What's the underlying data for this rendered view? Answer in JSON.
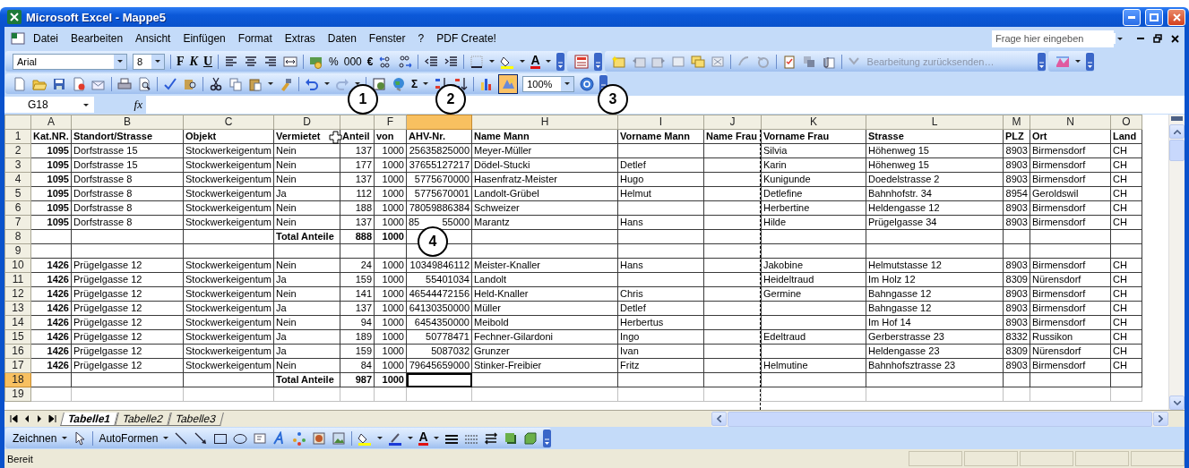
{
  "window": {
    "title": "Microsoft Excel - Mappe5"
  },
  "menu": {
    "items": [
      "Datei",
      "Bearbeiten",
      "Ansicht",
      "Einfügen",
      "Format",
      "Extras",
      "Daten",
      "Fenster",
      "?",
      "PDF Create!"
    ],
    "ask_box": {
      "placeholder": "Frage hier eingeben"
    }
  },
  "format_toolbar": {
    "font": "Arial",
    "size": "8",
    "bold": "F",
    "italic": "K",
    "underline": "U",
    "percent": "%",
    "thousands": "000",
    "euro": "€",
    "font_color": "A"
  },
  "review_toolbar": {
    "send_back": "Bearbeitung zurücksenden…"
  },
  "standard_toolbar": {
    "sum": "Σ",
    "zoom": "100%"
  },
  "formula_bar": {
    "name_box": "G18",
    "fx": "fx"
  },
  "sheet": {
    "columns": [
      {
        "label": "A",
        "kind": "number",
        "selected": false
      },
      {
        "label": "B",
        "selected": false
      },
      {
        "label": "C",
        "selected": false
      },
      {
        "label": "D",
        "selected": false
      },
      {
        "kind": "number",
        "selected": false
      },
      {
        "label": "F",
        "kind": "number",
        "selected": false
      },
      {
        "kind": "number",
        "selected": true
      },
      {
        "label": "H",
        "selected": false
      },
      {
        "label": "I",
        "selected": false
      },
      {
        "label": "J",
        "selected": false
      },
      {
        "label": "K",
        "selected": false,
        "page_break_before": true
      },
      {
        "label": "L",
        "selected": false
      },
      {
        "label": "M",
        "kind": "number",
        "selected": false
      },
      {
        "label": "N",
        "selected": false
      },
      {
        "label": "O",
        "selected": false
      }
    ],
    "rows": [
      {
        "label": "1",
        "kind": "header",
        "selected": false,
        "cells": [
          "Kat.NR.",
          "Standort/Strasse",
          "Objekt",
          "Vermietet",
          "Anteil",
          "von",
          "AHV-Nr.",
          "Name Mann",
          "Vorname Mann",
          "Name Frau",
          "Vorname Frau",
          "Strasse",
          "PLZ",
          "Ort",
          "Land"
        ]
      },
      {
        "label": "2",
        "kind": "data",
        "selected": false,
        "cells": [
          "1095",
          "Dorfstrasse 15",
          "Stockwerkeigentum",
          "Nein",
          "137",
          "1000",
          "25635825000",
          "Meyer-Müller",
          null,
          null,
          "Silvia",
          "Höhenweg 15",
          "8903",
          "Birmensdorf",
          "CH"
        ]
      },
      {
        "label": "3",
        "kind": "data",
        "selected": false,
        "cells": [
          "1095",
          "Dorfstrasse 15",
          "Stockwerkeigentum",
          "Nein",
          "177",
          "1000",
          "37655127217",
          "Dödel-Stucki",
          "Detlef",
          null,
          "Karin",
          "Höhenweg 15",
          "8903",
          "Birmensdorf",
          "CH"
        ]
      },
      {
        "label": "4",
        "kind": "data",
        "selected": false,
        "cells": [
          "1095",
          "Dorfstrasse  8",
          "Stockwerkeigentum",
          "Nein",
          "137",
          "1000",
          "5775670000",
          "Hasenfratz-Meister",
          "Hugo",
          null,
          "Kunigunde",
          "Doedelstrasse 2",
          "8903",
          "Birmensdorf",
          "CH"
        ]
      },
      {
        "label": "5",
        "kind": "data",
        "selected": false,
        "cells": [
          "1095",
          "Dorfstrasse  8",
          "Stockwerkeigentum",
          "Ja",
          "112",
          "1000",
          "5775670001",
          "Landolt-Grübel",
          "Helmut",
          null,
          "Detlefine",
          "Bahnhofstr. 34",
          "8954",
          "Geroldswil",
          "CH"
        ]
      },
      {
        "label": "6",
        "kind": "data",
        "selected": false,
        "cells": [
          "1095",
          "Dorfstrasse  8",
          "Stockwerkeigentum",
          "Nein",
          "188",
          "1000",
          "78059886384",
          "Schweizer",
          null,
          null,
          "Herbertine",
          "Heldengasse 12",
          "8903",
          "Birmensdorf",
          "CH"
        ]
      },
      {
        "label": "7",
        "kind": "data",
        "selected": false,
        "cells": [
          "1095",
          "Dorfstrasse  8",
          "Stockwerkeigentum",
          "Nein",
          "137",
          "1000",
          [
            "85",
            "55000"
          ],
          "Marantz",
          "Hans",
          null,
          "Hilde",
          "Prügelgasse 34",
          "8903",
          "Birmensdorf",
          "CH"
        ]
      },
      {
        "label": "8",
        "kind": "total",
        "selected": false,
        "cells": [
          null,
          null,
          null,
          "Total Anteile",
          "888",
          "1000"
        ]
      },
      {
        "label": "9",
        "kind": "data",
        "selected": false,
        "cells": []
      },
      {
        "label": "10",
        "kind": "data",
        "selected": false,
        "cells": [
          "1426",
          "Prügelgasse 12",
          "Stockwerkeigentum",
          "Nein",
          "24",
          "1000",
          "10349846112",
          "Meister-Knaller",
          "Hans",
          null,
          "Jakobine",
          "Helmutstasse 12",
          "8903",
          "Birmensdorf",
          "CH"
        ]
      },
      {
        "label": "11",
        "kind": "data",
        "selected": false,
        "cells": [
          "1426",
          "Prügelgasse 12",
          "Stockwerkeigentum",
          "Ja",
          "159",
          "1000",
          "55401034",
          "Landolt",
          null,
          null,
          "Heideltraud",
          "Im Holz 12",
          "8309",
          "Nürensdorf",
          "CH"
        ]
      },
      {
        "label": "12",
        "kind": "data",
        "selected": false,
        "cells": [
          "1426",
          "Prügelgasse 12",
          "Stockwerkeigentum",
          "Nein",
          "141",
          "1000",
          "46544472156",
          "Held-Knaller",
          "Chris",
          null,
          "Germine",
          "Bahngasse 12",
          "8903",
          "Birmensdorf",
          "CH"
        ]
      },
      {
        "label": "13",
        "kind": "data",
        "selected": false,
        "cells": [
          "1426",
          "Prügelgasse 12",
          "Stockwerkeigentum",
          "Ja",
          "137",
          "1000",
          "64130350000",
          "Müller",
          "Detlef",
          null,
          null,
          "Bahngasse 12",
          "8903",
          "Birmensdorf",
          "CH"
        ]
      },
      {
        "label": "14",
        "kind": "data",
        "selected": false,
        "cells": [
          "1426",
          "Prügelgasse 12",
          "Stockwerkeigentum",
          "Nein",
          "94",
          "1000",
          "6454350000",
          "Meibold",
          "Herbertus",
          null,
          null,
          "Im Hof 14",
          "8903",
          "Birmensdorf",
          "CH"
        ]
      },
      {
        "label": "15",
        "kind": "data",
        "selected": false,
        "cells": [
          "1426",
          "Prügelgasse 12",
          "Stockwerkeigentum",
          "Ja",
          "189",
          "1000",
          "50778471",
          "Fechner-Gilardoni",
          "Ingo",
          null,
          "Edeltraud",
          "Gerberstrasse 23",
          "8332",
          "Russikon",
          "CH"
        ]
      },
      {
        "label": "16",
        "kind": "data",
        "selected": false,
        "cells": [
          "1426",
          "Prügelgasse 12",
          "Stockwerkeigentum",
          "Ja",
          "159",
          "1000",
          "5087032",
          "Grunzer",
          "Ivan",
          null,
          null,
          "Heldengasse 23",
          "8309",
          "Nürensdorf",
          "CH"
        ]
      },
      {
        "label": "17",
        "kind": "data",
        "selected": false,
        "cells": [
          "1426",
          "Prügelgasse 12",
          "Stockwerkeigentum",
          "Nein",
          "84",
          "1000",
          "79645659000",
          "Stinker-Freibier",
          "Fritz",
          null,
          "Helmutine",
          "Bahnhofsztrasse 23",
          "8903",
          "Birmensdorf",
          "CH"
        ]
      },
      {
        "label": "18",
        "kind": "total",
        "selected": true,
        "cells": [
          null,
          null,
          null,
          "Total Anteile",
          "987",
          "1000"
        ]
      },
      {
        "label": "19",
        "kind": "blank",
        "selected": false,
        "cells": []
      }
    ]
  },
  "sheet_tabs": [
    {
      "label": "Tabelle1",
      "selected": true
    },
    {
      "label": "Tabelle2",
      "selected": false
    },
    {
      "label": "Tabelle3",
      "selected": false
    }
  ],
  "drawing_toolbar": {
    "draw": "Zeichnen",
    "autoshapes": "AutoFormen",
    "font_color": "A"
  },
  "callouts": [
    {
      "label": "1"
    },
    {
      "label": "2"
    },
    {
      "label": "3"
    },
    {
      "label": "4"
    }
  ],
  "status_bar": {
    "text": "Bereit"
  }
}
